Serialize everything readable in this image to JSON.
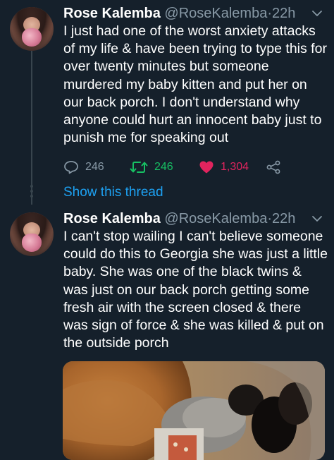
{
  "tweets": [
    {
      "author_name": "Rose Kalemba",
      "handle": "@RoseKalemba",
      "separator": "·",
      "time": "22h",
      "text": "I just had one of the worst anxiety attacks of my life & have been trying to type this for over twenty minutes but someone murdered my baby kitten and put her on our back porch. I don't understand why anyone could hurt an innocent baby just to punish me for speaking out",
      "replies": "246",
      "retweets": "246",
      "likes": "1,304"
    },
    {
      "author_name": "Rose Kalemba",
      "handle": "@RoseKalemba",
      "separator": "·",
      "time": "22h",
      "text": "I can't stop wailing I can't believe someone could do this to Georgia she was just a little baby. She was one of the black twins & was just on our back porch getting some fresh air with the screen closed & there was sign of force & she was killed & put on the outside porch"
    }
  ],
  "show_thread": "Show this thread",
  "colors": {
    "background": "#15202b",
    "muted": "#8899a6",
    "link": "#1da1f2",
    "retweet": "#17bf63",
    "like": "#e0245e"
  },
  "icons": [
    "reply-icon",
    "retweet-icon",
    "heart-icon",
    "share-icon",
    "chevron-down-icon"
  ]
}
